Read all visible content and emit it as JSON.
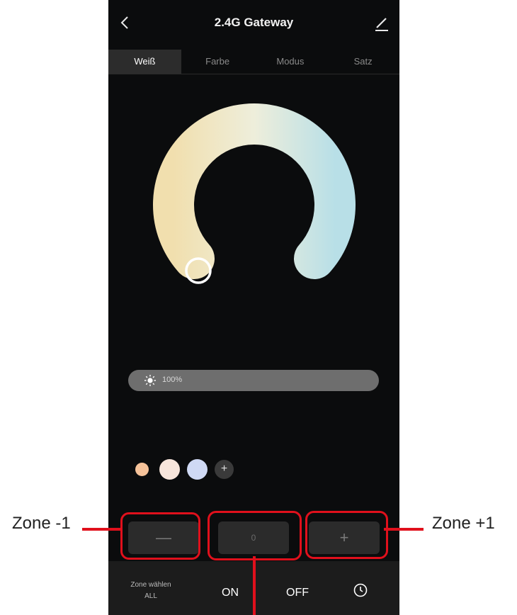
{
  "header": {
    "title": "2.4G Gateway",
    "back_icon": "chevron-left-icon",
    "edit_icon": "pencil-icon"
  },
  "tabs": [
    {
      "label": "Weiß",
      "active": true
    },
    {
      "label": "Farbe",
      "active": false
    },
    {
      "label": "Modus",
      "active": false
    },
    {
      "label": "Satz",
      "active": false
    }
  ],
  "color_wheel": {
    "warm_color": "#f1dfae",
    "cold_color": "#b8dfe7"
  },
  "brightness": {
    "value_label": "100%",
    "level": 1.0,
    "icon": "sun-icon"
  },
  "swatches": [
    {
      "name": "warm",
      "color": "#f6c39a"
    },
    {
      "name": "neutral",
      "color": "#f8e6dc"
    },
    {
      "name": "cool",
      "color": "#cfd9f4"
    }
  ],
  "add_swatch_label": "+",
  "zone_controls": {
    "minus_label": "—",
    "zone_value": "0",
    "plus_label": "+"
  },
  "bottom_bar": {
    "zone_label": "Zone wählen",
    "zone_value": "ALL",
    "on_label": "ON",
    "off_label": "OFF",
    "clock_icon": "clock-icon"
  },
  "annotations": {
    "left": "Zone -1",
    "right": "Zone +1"
  },
  "colors": {
    "highlight": "#e0101c",
    "background": "#0b0c0d"
  }
}
